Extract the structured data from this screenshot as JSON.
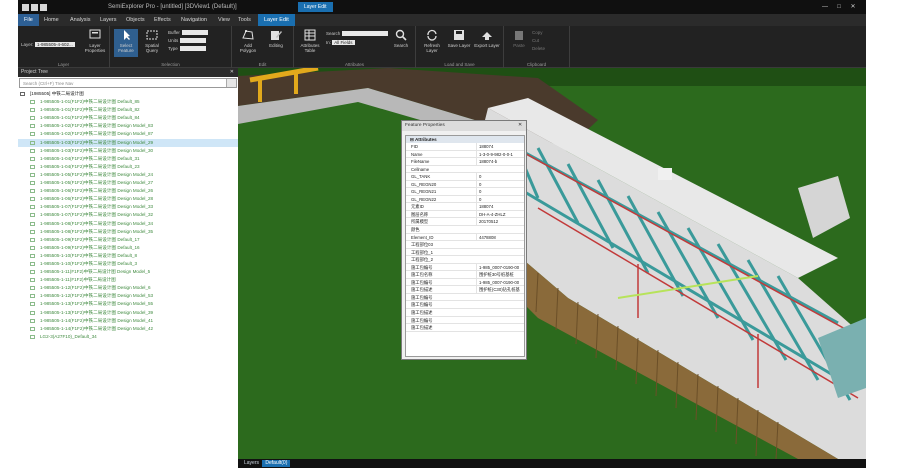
{
  "window": {
    "title": "SemiExplorer Pro - [untitled] [3DView1 (Default)]",
    "context_tab": "Layer Edit",
    "controls": [
      "—",
      "□",
      "✕"
    ]
  },
  "tabs": [
    "File",
    "Home",
    "Analysis",
    "Layers",
    "Objects",
    "Effects",
    "Navigation",
    "View",
    "Tools",
    "Layer Edit"
  ],
  "ribbon": {
    "layer_label": "Layer:",
    "layer_value": "1-985505-4-602...",
    "groups": {
      "layer": {
        "label": "Layer",
        "buttons": [
          "Layer Properties"
        ]
      },
      "selection": {
        "label": "Selection",
        "buttons": [
          "Select Feature",
          "Spatial Query"
        ],
        "fields": [
          {
            "label": "Buffer",
            "value": "0"
          },
          {
            "label": "Units",
            "value": "Meters"
          },
          {
            "label": "Type",
            "value": "Intersect"
          }
        ]
      },
      "edit": {
        "label": "Edit",
        "buttons": [
          "Add Polygon",
          "Editing"
        ]
      },
      "attributes": {
        "label": "Attributes",
        "buttons": [
          "Attributes Table",
          "Search"
        ],
        "field_label": "Search",
        "in_label": "In:",
        "in_value": "All Fields"
      },
      "load": {
        "label": "Load and Save",
        "buttons": [
          "Refresh Layer",
          "Save Layer",
          "Export Layer"
        ]
      },
      "clipboard": {
        "label": "Clipboard",
        "buttons": [
          "Paste"
        ],
        "small": [
          "Copy",
          "Cut",
          "Delete"
        ]
      }
    }
  },
  "tree": {
    "header": "Project Tree",
    "close": "✕",
    "search_placeholder": "Search (Ctrl+F) Tree Nav",
    "root": "[1985505] 中铁二局设计图",
    "items": [
      "1-985505-1-01(F1F2)中铁二局设计图 Default_85",
      "1-985505-1-01(F1F2)中铁二局设计图 Default_82",
      "1-985505-1-01(F1F2)中铁二局设计图 Default_84",
      "1-985505-1-02(F1F2)中铁二局设计图 Design Model_83",
      "1-985505-1-02(F1F2)中铁二局设计图 Design Model_87",
      "1-985505-1-03(F1F2)中铁二局设计图 Design Model_29",
      "1-985505-1-03(F1F2)中铁二局设计图 Design Model_30",
      "1-985505-1-04(F1F2)中铁二局设计图 Default_31",
      "1-985505-1-04(F1F2)中铁二局设计图 Default_23",
      "1-985505-1-05(F1F2)中铁二局设计图 Design Model_24",
      "1-985505-1-05(F1F2)中铁二局设计图 Design Model_27",
      "1-985505-1-06(F1F2)中铁二局设计图 Design Model_26",
      "1-985505-1-06(F1F2)中铁二局设计图 Design Model_28",
      "1-985505-1-07(F1F2)中铁二局设计图 Design Model_33",
      "1-985505-1-07(F1F2)中铁二局设计图 Design Model_32",
      "1-985505-1-08(F1F2)中铁二局设计图 Design Model_34",
      "1-985505-1-08(F1F2)中铁二局设计图 Design Model_35",
      "1-985505-1-09(F1F2)中铁二局设计图 Default_17",
      "1-985505-1-09(F1F2)中铁二局设计图 Default_16",
      "1-985505-1-10(F1F2)中铁二局设计图 Default_8",
      "1-985505-1-10(F1F2)中铁二局设计图 Default_3",
      "1-985505-1-11(F1F2)中铁二局设计图 Design Model_5",
      "1-985505-1-11(F1F2)中铁二局设计图",
      "1-985505-1-12(F1F2)中铁二局设计图 Design Model_6",
      "1-985505-1-12(F1F2)中铁二局设计图 Design Model_53",
      "1-985505-1-13(F1F2)中铁二局设计图 Design Model_55",
      "1-985505-1-13(F1F2)中铁二局设计图 Design Model_39",
      "1-985505-1-14(F1F2)中铁二局设计图 Design Model_41",
      "1-985505-1-14(F1F2)中铁二局设计图 Design Model_42",
      "LG2-3(A27F10)_Default_34"
    ]
  },
  "properties": {
    "title": "Feature Properties",
    "close": "✕",
    "category": "Attributes",
    "rows": [
      {
        "key": "FID",
        "value": "188074"
      },
      {
        "key": "Name",
        "value": "1-3-0-9-982-0-0-1"
      },
      {
        "key": "FileName",
        "value": "188074-b"
      },
      {
        "key": "Cellname",
        "value": ""
      },
      {
        "key": "GL_TANK",
        "value": "0"
      },
      {
        "key": "GL_REGN20",
        "value": "0"
      },
      {
        "key": "GL_REGN21",
        "value": "0"
      },
      {
        "key": "GL_REGN22",
        "value": "0"
      },
      {
        "key": "元素ID",
        "value": "188074"
      },
      {
        "key": "图层名称",
        "value": "DH-A-4-ZHLZ"
      },
      {
        "key": "所属模型",
        "value": "20170512"
      },
      {
        "key": "颜色",
        "value": ""
      },
      {
        "key": "Element_ID",
        "value": "4478808"
      },
      {
        "key": "工程部位03",
        "value": ""
      },
      {
        "key": "工程部位_1",
        "value": ""
      },
      {
        "key": "工程部位_2",
        "value": ""
      },
      {
        "key": "施工包编号",
        "value": "1-985_0007-0190-00"
      },
      {
        "key": "施工包名称",
        "value": "围护桩30号桩基桩"
      },
      {
        "key": "施工包编号",
        "value": "1-985_0007-0190-00"
      },
      {
        "key": "施工包描述",
        "value": "围护桩(C30)钻孔桩基"
      },
      {
        "key": "施工包编号",
        "value": ""
      },
      {
        "key": "施工包编号",
        "value": ""
      },
      {
        "key": "施工包描述",
        "value": ""
      },
      {
        "key": "施工包编号",
        "value": ""
      },
      {
        "key": "施工包描述",
        "value": ""
      }
    ]
  },
  "status": {
    "label": "Layers",
    "badge": "Default(0)"
  },
  "colors": {
    "accent": "#1a6fb0",
    "ground": "#2c6a1d",
    "tree_text": "#3f8a3f"
  }
}
